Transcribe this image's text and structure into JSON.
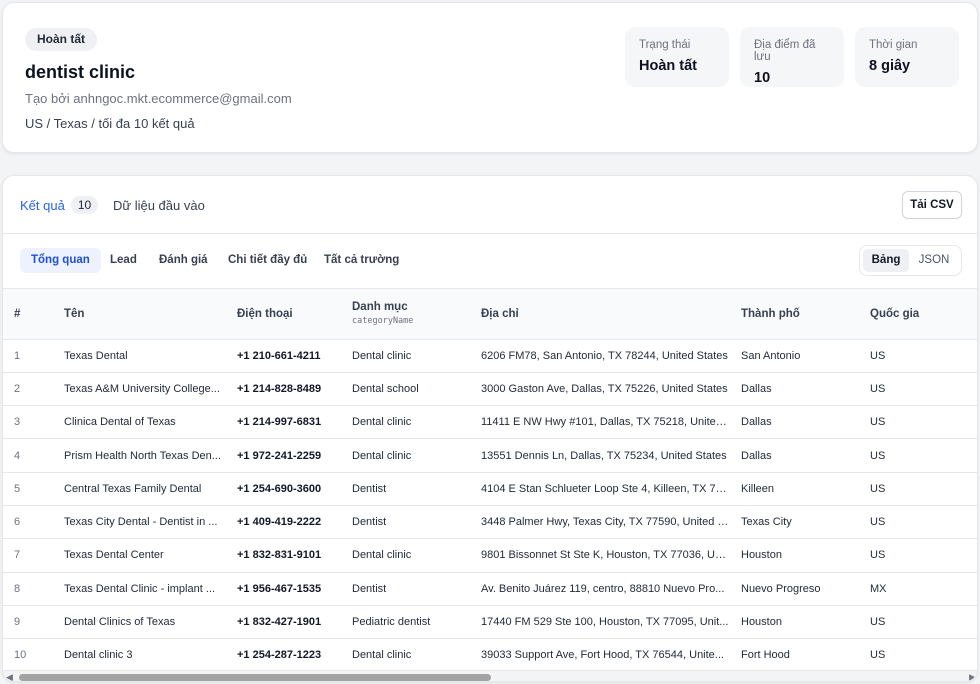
{
  "job": {
    "status_badge": "Hoàn tất",
    "title": "dentist clinic",
    "created_by": "Tạo bởi anhngoc.mkt.ecommerce@gmail.com",
    "scope": "US / Texas / tối đa 10 kết quả"
  },
  "stats": [
    {
      "label": "Trạng thái",
      "value": "Hoàn tất"
    },
    {
      "label": "Địa điểm đã lưu",
      "value": "10"
    },
    {
      "label": "Thời gian",
      "value": "8 giây"
    }
  ],
  "tabs": {
    "results_label": "Kết quả",
    "results_count": "10",
    "input_label": "Dữ liệu đầu vào",
    "csv_button": "Tải CSV"
  },
  "sub_tabs": [
    "Tổng quan",
    "Lead",
    "Đánh giá",
    "Chi tiết đầy đủ",
    "Tất cả trường"
  ],
  "view_toggle": {
    "table": "Bảng",
    "json": "JSON"
  },
  "columns": {
    "idx": "#",
    "name": "Tên",
    "phone": "Điện thoại",
    "category": "Danh mục",
    "category_key": "categoryName",
    "address": "Địa chỉ",
    "city": "Thành phố",
    "country": "Quốc gia"
  },
  "rows": [
    {
      "idx": "1",
      "name": "Texas Dental",
      "phone": "+1 210-661-4211",
      "category": "Dental clinic",
      "address": "6206 FM78, San Antonio, TX 78244, United States",
      "city": "San Antonio",
      "country": "US"
    },
    {
      "idx": "2",
      "name": "Texas A&M University College...",
      "phone": "+1 214-828-8489",
      "category": "Dental school",
      "address": "3000 Gaston Ave, Dallas, TX 75226, United States",
      "city": "Dallas",
      "country": "US"
    },
    {
      "idx": "3",
      "name": "Clinica Dental of Texas",
      "phone": "+1 214-997-6831",
      "category": "Dental clinic",
      "address": "11411 E NW Hwy #101, Dallas, TX 75218, United...",
      "city": "Dallas",
      "country": "US"
    },
    {
      "idx": "4",
      "name": "Prism Health North Texas Den...",
      "phone": "+1 972-241-2259",
      "category": "Dental clinic",
      "address": "13551 Dennis Ln, Dallas, TX 75234, United States",
      "city": "Dallas",
      "country": "US"
    },
    {
      "idx": "5",
      "name": "Central Texas Family Dental",
      "phone": "+1 254-690-3600",
      "category": "Dentist",
      "address": "4104 E Stan Schlueter Loop Ste 4, Killeen, TX 76...",
      "city": "Killeen",
      "country": "US"
    },
    {
      "idx": "6",
      "name": "Texas City Dental - Dentist in ...",
      "phone": "+1 409-419-2222",
      "category": "Dentist",
      "address": "3448 Palmer Hwy, Texas City, TX 77590, United S...",
      "city": "Texas City",
      "country": "US"
    },
    {
      "idx": "7",
      "name": "Texas Dental Center",
      "phone": "+1 832-831-9101",
      "category": "Dental clinic",
      "address": "9801 Bissonnet St Ste K, Houston, TX 77036, Uni...",
      "city": "Houston",
      "country": "US"
    },
    {
      "idx": "8",
      "name": "Texas Dental Clinic - implant ...",
      "phone": "+1 956-467-1535",
      "category": "Dentist",
      "address": "Av. Benito Juárez 119, centro, 88810 Nuevo Pro...",
      "city": "Nuevo Progreso",
      "country": "MX"
    },
    {
      "idx": "9",
      "name": "Dental Clinics of Texas",
      "phone": "+1 832-427-1901",
      "category": "Pediatric dentist",
      "address": "17440 FM 529 Ste 100, Houston, TX 77095, Unit...",
      "city": "Houston",
      "country": "US"
    },
    {
      "idx": "10",
      "name": "Dental clinic 3",
      "phone": "+1 254-287-1223",
      "category": "Dental clinic",
      "address": "39033 Support Ave, Fort Hood, TX 76544, Unite...",
      "city": "Fort Hood",
      "country": "US"
    }
  ],
  "icons": {
    "scroll_left": "arrow-left-icon",
    "scroll_right": "arrow-right-icon"
  }
}
